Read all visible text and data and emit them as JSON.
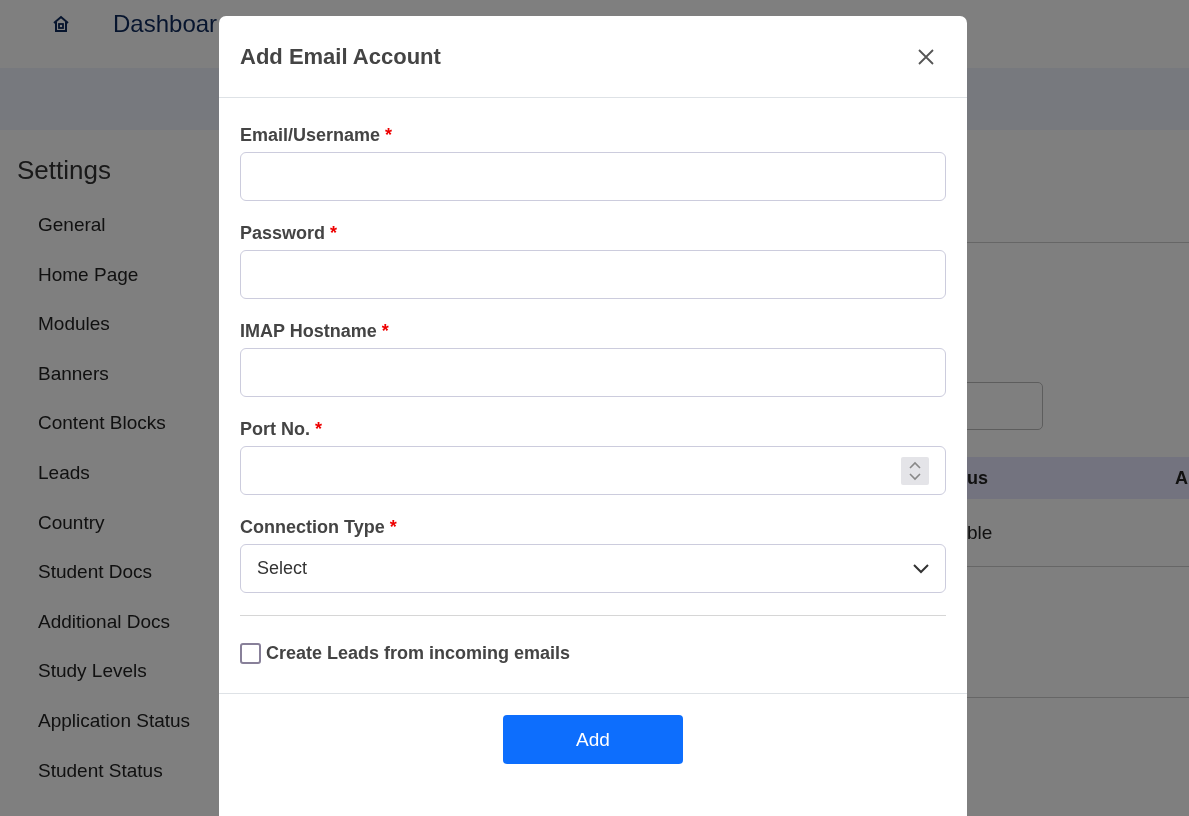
{
  "topbar": {
    "breadcrumb": "Dashboar"
  },
  "sidebar": {
    "title": "Settings",
    "items": [
      {
        "label": "General"
      },
      {
        "label": "Home Page"
      },
      {
        "label": "Modules"
      },
      {
        "label": "Banners"
      },
      {
        "label": "Content Blocks"
      },
      {
        "label": "Leads"
      },
      {
        "label": "Country"
      },
      {
        "label": "Student Docs"
      },
      {
        "label": "Additional Docs"
      },
      {
        "label": "Study Levels"
      },
      {
        "label": "Application Status"
      },
      {
        "label": "Student Status"
      }
    ]
  },
  "table": {
    "columns": [
      "us",
      "A"
    ],
    "rows": [
      [
        "ble"
      ]
    ]
  },
  "modal": {
    "title": "Add Email Account",
    "fields": [
      {
        "label": "Email/Username",
        "mark": "*",
        "kind": "text"
      },
      {
        "label": "Password",
        "mark": "*",
        "kind": "password"
      },
      {
        "label": "IMAP Hostname",
        "mark": "*",
        "kind": "text"
      },
      {
        "label": "Port No.",
        "mark": "*",
        "kind": "number"
      },
      {
        "label": "Connection Type",
        "mark": "*",
        "kind": "select",
        "value": "Select"
      }
    ],
    "checkbox": {
      "label": "Create Leads from incoming emails",
      "checked": false
    },
    "submit": "Add"
  }
}
